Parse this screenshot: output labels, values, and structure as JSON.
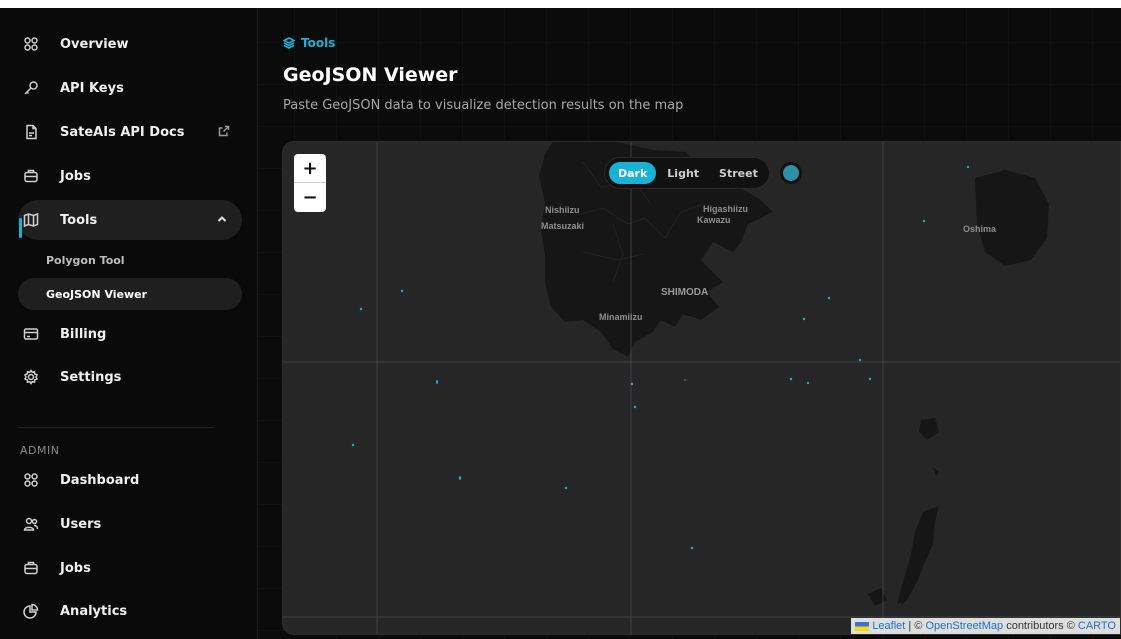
{
  "sidebar": {
    "items": [
      {
        "label": "Overview",
        "icon": "grid-icon"
      },
      {
        "label": "API Keys",
        "icon": "key-icon"
      },
      {
        "label": "SateAIs API Docs",
        "icon": "document-icon",
        "external": true
      },
      {
        "label": "Jobs",
        "icon": "briefcase-icon"
      },
      {
        "label": "Tools",
        "icon": "map-icon",
        "expanded": true,
        "active": true
      },
      {
        "label": "Billing",
        "icon": "credit-card-icon"
      },
      {
        "label": "Settings",
        "icon": "gear-icon"
      }
    ],
    "tools_children": [
      {
        "label": "Polygon Tool"
      },
      {
        "label": "GeoJSON Viewer",
        "active": true
      }
    ],
    "admin_section_label": "ADMIN",
    "admin_items": [
      {
        "label": "Dashboard",
        "icon": "grid-icon"
      },
      {
        "label": "Users",
        "icon": "users-icon"
      },
      {
        "label": "Jobs",
        "icon": "briefcase-icon"
      },
      {
        "label": "Analytics",
        "icon": "pie-chart-icon"
      }
    ]
  },
  "header": {
    "breadcrumb": "Tools",
    "title": "GeoJSON Viewer",
    "subtitle": "Paste GeoJSON data to visualize detection results on the map"
  },
  "map": {
    "zoom_in": "+",
    "zoom_out": "−",
    "styles": [
      "Dark",
      "Light",
      "Street"
    ],
    "active_style": "Dark",
    "layer_color": "#2f8ea8",
    "places": {
      "nishiizu": "Nishiizu",
      "matsuzaki": "Matsuzaki",
      "higashiizu": "Higashiizu",
      "kawazu": "Kawazu",
      "shimoda": "SHIMODA",
      "minamiizu": "Minamiizu",
      "oshima": "Oshima"
    },
    "attribution": {
      "leaflet": "Leaflet",
      "sep1": " | © ",
      "osm": "OpenStreetMap",
      "contributors": " contributors © ",
      "carto": "CARTO"
    }
  },
  "colors": {
    "accent": "#17b2d6",
    "background": "#0b0b0b",
    "map_background": "#262626",
    "land": "#161616"
  }
}
